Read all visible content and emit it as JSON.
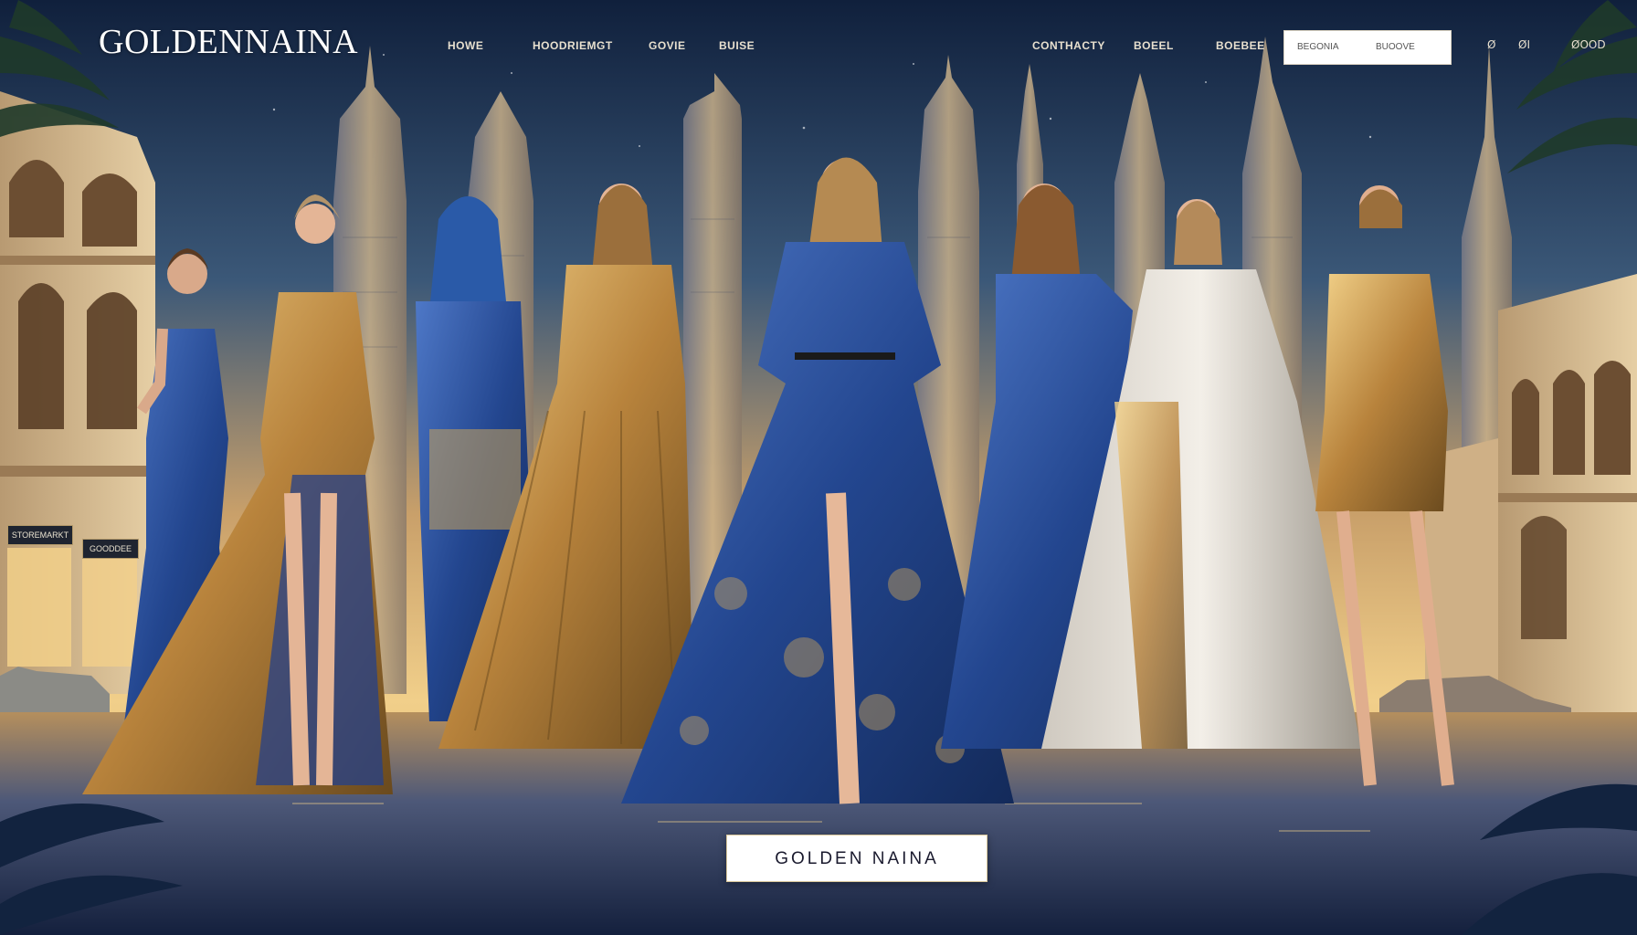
{
  "header": {
    "brand": "GOLDENNAINA",
    "nav_left": [
      "HOWE",
      "HOODRIEMGT",
      "GOVIE",
      "BUISE"
    ],
    "nav_right": [
      "CONTHACTY",
      "BOEEL",
      "BOEBEE"
    ],
    "search": {
      "label_1": "BEGONIA",
      "label_2": "BUOOVE"
    },
    "icons": [
      "Ø",
      "ØI",
      "ØOOD"
    ]
  },
  "storefront": {
    "sign_left": "STOREMARKT",
    "sign_right": "GOODDEE"
  },
  "cta": {
    "label": "GOLDEN NAINA"
  },
  "colors": {
    "sky_top": "#13223f",
    "horizon": "#f2c978",
    "accent_gold": "#c9a25a",
    "accent_blue": "#2a4f95"
  }
}
